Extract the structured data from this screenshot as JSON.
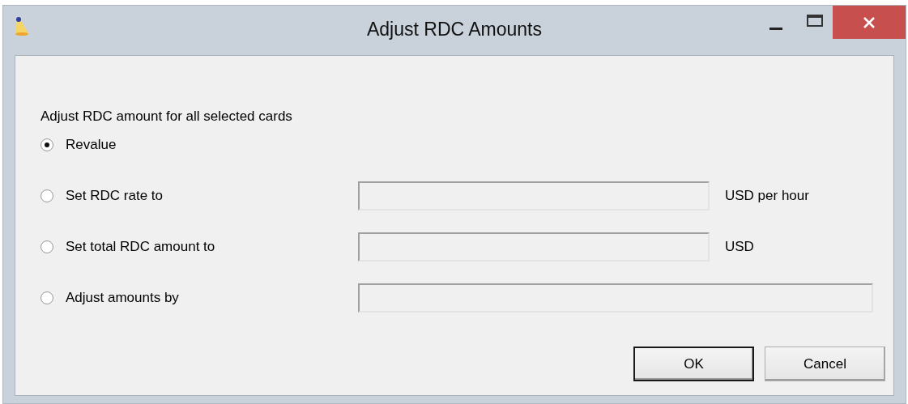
{
  "window": {
    "title": "Adjust RDC Amounts"
  },
  "heading": "Adjust RDC amount for all selected cards",
  "options": [
    {
      "label": "Revalue",
      "selected": true
    },
    {
      "label": "Set RDC rate to",
      "selected": false,
      "field": {
        "disabled": true
      },
      "unit": "USD per hour"
    },
    {
      "label": "Set total RDC amount to",
      "selected": false,
      "field": {
        "disabled": true
      },
      "unit": "USD"
    },
    {
      "label": "Adjust amounts by",
      "selected": false,
      "field": {
        "disabled": true,
        "wide": true
      }
    }
  ],
  "buttons": [
    {
      "label": "OK",
      "default": true
    },
    {
      "label": "Cancel",
      "default": false
    }
  ]
}
